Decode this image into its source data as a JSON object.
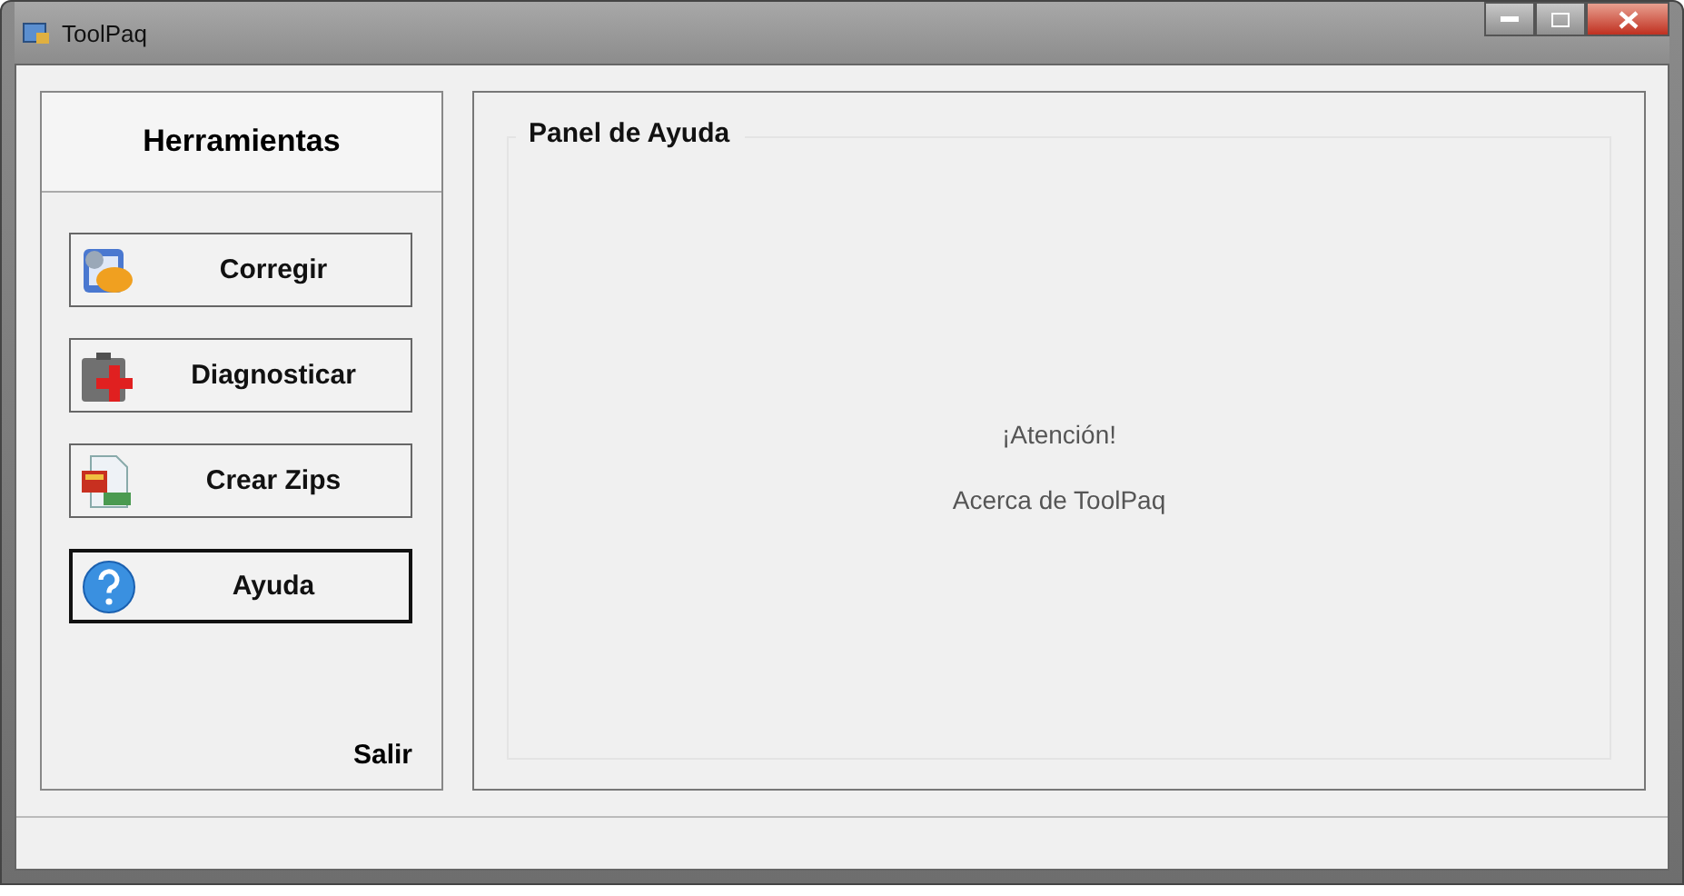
{
  "window": {
    "title": "ToolPaq"
  },
  "sidebar": {
    "title": "Herramientas",
    "items": [
      {
        "label": "Corregir",
        "selected": false
      },
      {
        "label": "Diagnosticar",
        "selected": false
      },
      {
        "label": "Crear Zips",
        "selected": false
      },
      {
        "label": "Ayuda",
        "selected": true
      }
    ],
    "exit": "Salir"
  },
  "panel": {
    "title": "Panel de Ayuda",
    "lines": [
      "¡Atención!",
      "Acerca de ToolPaq"
    ]
  }
}
